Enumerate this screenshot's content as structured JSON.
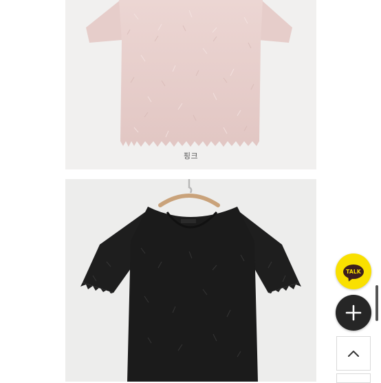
{
  "products": [
    {
      "color_label": "핑크",
      "garment_color": "#e8cfcc"
    },
    {
      "color_label": "",
      "garment_color": "#1b1b1b"
    }
  ],
  "floating": {
    "talk_label": "TALK",
    "talk_color": "#f9e000",
    "plus_icon": "plus-icon",
    "top_icon": "chevron-up-icon"
  }
}
